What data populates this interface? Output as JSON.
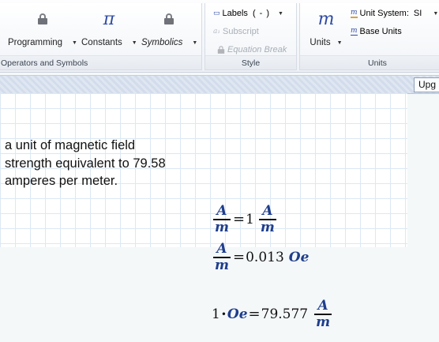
{
  "ribbon": {
    "operators_group": {
      "label": "Operators and Symbols",
      "programming": "Programming",
      "constants": "Constants",
      "symbolics": "Symbolics",
      "constants_glyph": "π"
    },
    "style_group": {
      "label": "Style",
      "labels": "Labels",
      "labels_value": "( - )",
      "subscript": "Subscript",
      "equation_break": "Equation Break"
    },
    "units_group": {
      "label": "Units",
      "units": "Units",
      "units_glyph": "m",
      "unit_system_label": "Unit System:",
      "unit_system_value": "SI",
      "base_units": "Base Units"
    }
  },
  "upgrade_button": "Upg",
  "worksheet": {
    "text_lines": [
      "a unit of magnetic field",
      "strength equivalent to 79.58",
      "amperes per meter."
    ],
    "eq1": {
      "num": "A",
      "den": "m",
      "equals": "=",
      "value": "1",
      "rnum": "A",
      "rden": "m"
    },
    "eq2": {
      "num": "A",
      "den": "m",
      "equals": "=",
      "value": "0.013",
      "unit": "Oe"
    },
    "eq3": {
      "lhs_value": "1",
      "dot": "•",
      "lhs_unit": "Oe",
      "equals": "=",
      "value": "79.577",
      "rnum": "A",
      "rden": "m"
    }
  },
  "colors": {
    "accent": "#2e4aa3",
    "unit": "#1f3e8c",
    "grid": "#dbe8f4"
  },
  "icons": [
    "lock-icon",
    "pi-icon",
    "m-units-icon",
    "labels-icon",
    "subscript-icon",
    "unit-system-icon",
    "base-units-icon"
  ]
}
